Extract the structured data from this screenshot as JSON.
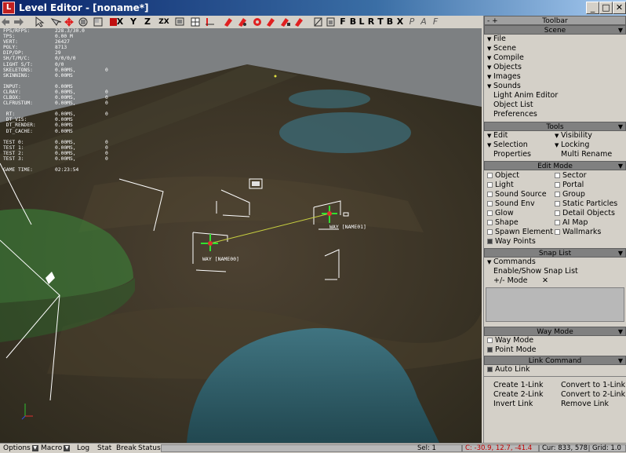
{
  "window": {
    "title": "Level Editor - [noname*]",
    "minimize": "_",
    "maximize": "□",
    "close": "✕"
  },
  "toolbar": {
    "buttons": [
      "X",
      "Y",
      "Z",
      "ZX",
      "F",
      "B",
      "L",
      "R",
      "T",
      "B",
      "X",
      "P",
      "A",
      "F"
    ]
  },
  "viewport": {
    "stats": [
      {
        "k": "FPS/RFPS:",
        "v": "228.3/30.0",
        "v2": ""
      },
      {
        "k": "TPS:",
        "v": "0.00 M",
        "v2": ""
      },
      {
        "k": "VERT:",
        "v": "26427",
        "v2": ""
      },
      {
        "k": "POLY:",
        "v": "8713",
        "v2": ""
      },
      {
        "k": "DIP/DP:",
        "v": "29",
        "v2": ""
      },
      {
        "k": "SH/T/M/C:",
        "v": "0/0/0/0",
        "v2": ""
      },
      {
        "k": "LIGHT S/T:",
        "v": "0/0",
        "v2": ""
      },
      {
        "k": "SKELETONS:",
        "v": "0.00MS,",
        "v2": "0"
      },
      {
        "k": "SKINNING:",
        "v": "0.00MS",
        "v2": ""
      },
      {
        "k": "",
        "v": "",
        "v2": ""
      },
      {
        "k": "INPUT:",
        "v": "0.00MS",
        "v2": ""
      },
      {
        "k": "CLRAY:",
        "v": "0.00MS,",
        "v2": "0"
      },
      {
        "k": "CLBOX:",
        "v": "0.00MS,",
        "v2": "0"
      },
      {
        "k": "CLFRUSTUM:",
        "v": "0.00MS,",
        "v2": "0"
      },
      {
        "k": "",
        "v": "",
        "v2": ""
      },
      {
        "k": " RT:",
        "v": "0.00MS,",
        "v2": "0"
      },
      {
        "k": " DT_VIS:",
        "v": "0.00MS",
        "v2": ""
      },
      {
        "k": " DT_RENDER:",
        "v": "0.00MS",
        "v2": ""
      },
      {
        "k": " DT_CACHE:",
        "v": "0.00MS",
        "v2": ""
      },
      {
        "k": "",
        "v": "",
        "v2": ""
      },
      {
        "k": "TEST 0:",
        "v": "0.00MS,",
        "v2": "0"
      },
      {
        "k": "TEST 1:",
        "v": "0.00MS,",
        "v2": "0"
      },
      {
        "k": "TEST 2:",
        "v": "0.00MS,",
        "v2": "0"
      },
      {
        "k": "TEST 3:",
        "v": "0.00MS,",
        "v2": "0"
      },
      {
        "k": "",
        "v": "",
        "v2": ""
      },
      {
        "k": "GAME TIME:",
        "v": "02:23:54",
        "v2": ""
      }
    ],
    "way_label_1": "WAY [NAME00]",
    "way_label_2": "WAY [NAME01]"
  },
  "panel": {
    "header": "Toolbar",
    "header_left": "- +",
    "scene": {
      "title": "Scene",
      "items": [
        "File",
        "Scene",
        "Compile",
        "Objects",
        "Images",
        "Sounds"
      ],
      "plain": [
        "Light Anim Editor",
        "Object List",
        "Preferences"
      ]
    },
    "tools": {
      "title": "Tools",
      "left": [
        "Edit",
        "Selection"
      ],
      "right": [
        "Visibility",
        "Locking"
      ],
      "plain_left": "Properties",
      "plain_right": "Multi Rename"
    },
    "edit_mode": {
      "title": "Edit Mode",
      "left": [
        "Object",
        "Light",
        "Sound Source",
        "Sound Env",
        "Glow",
        "Shape",
        "Spawn Element"
      ],
      "right": [
        "Sector",
        "Portal",
        "Group",
        "Static Particles",
        "Detail Objects",
        "AI Map",
        "Wallmarks"
      ],
      "last": "Way Points"
    },
    "snap_list": {
      "title": "Snap List",
      "commands": "Commands",
      "enable": "Enable/Show Snap List",
      "mode": "+/- Mode",
      "x": "✕"
    },
    "way_mode": {
      "title": "Way Mode",
      "items": [
        "Way Mode",
        "Point Mode"
      ]
    },
    "link_command": {
      "title": "Link Command",
      "auto": "Auto Link",
      "left": [
        "Create 1-Link",
        "Create 2-Link",
        "Invert Link"
      ],
      "right": [
        "Convert to 1-Link",
        "Convert to 2-Link",
        "Remove Link"
      ]
    }
  },
  "statusbar": {
    "options": "Options",
    "macro": "Macro",
    "log": "Log",
    "stat": "Stat",
    "break": "Break",
    "status": "Status:",
    "sel": "Sel: 1",
    "coords": "C: -30.9, 12.7, -41.4",
    "cur": "Cur: 833, 578",
    "grid": "Grid: 1.0"
  }
}
